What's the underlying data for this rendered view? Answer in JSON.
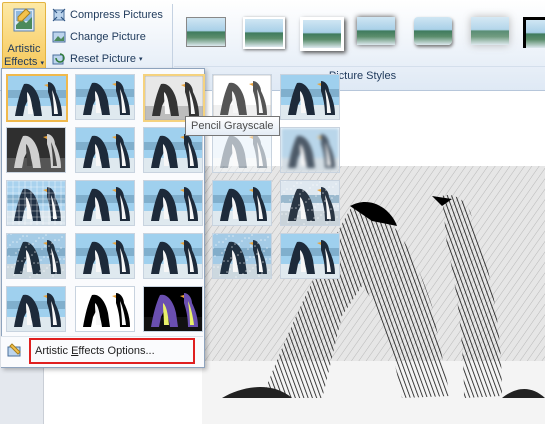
{
  "ribbon": {
    "artistic_effects": {
      "label_line1": "Artistic",
      "label_line2": "Effects",
      "caret": "▾"
    },
    "commands": [
      {
        "label": "Compress Pictures",
        "icon": "compress-pictures-icon"
      },
      {
        "label": "Change Picture",
        "icon": "change-picture-icon"
      },
      {
        "label": "Reset Picture",
        "icon": "reset-picture-icon",
        "caret": "▾"
      }
    ],
    "picture_styles_label": "Picture Styles",
    "style_thumbs": [
      "style-1",
      "style-2",
      "style-3",
      "style-4",
      "style-5",
      "style-6",
      "style-7"
    ]
  },
  "gallery": {
    "effects": [
      {
        "name": "effect-none",
        "style": "normal",
        "selected": true
      },
      {
        "name": "effect-marker",
        "style": "normal"
      },
      {
        "name": "effect-pencil-grayscale",
        "style": "gray",
        "hovered": true
      },
      {
        "name": "effect-pencil-sketch",
        "style": "sketch"
      },
      {
        "name": "effect-line-drawing",
        "style": "normal"
      },
      {
        "name": "effect-chalk-sketch",
        "style": "dark"
      },
      {
        "name": "effect-paint-strokes",
        "style": "normal"
      },
      {
        "name": "effect-paint-brush",
        "style": "normal"
      },
      {
        "name": "effect-glow-diffused",
        "style": "washed"
      },
      {
        "name": "effect-blur",
        "style": "blur"
      },
      {
        "name": "effect-light-screen",
        "style": "grid"
      },
      {
        "name": "effect-watercolor-sponge",
        "style": "normal"
      },
      {
        "name": "effect-film-grain",
        "style": "normal"
      },
      {
        "name": "effect-mosaic-bubbles",
        "style": "normal"
      },
      {
        "name": "effect-glass",
        "style": "noisy"
      },
      {
        "name": "effect-cement",
        "style": "dotted"
      },
      {
        "name": "effect-texturizer",
        "style": "normal"
      },
      {
        "name": "effect-crisscross-etching",
        "style": "normal"
      },
      {
        "name": "effect-pastels-smooth",
        "style": "dotted"
      },
      {
        "name": "effect-plastic-wrap",
        "style": "normal"
      },
      {
        "name": "effect-photocopy",
        "style": "normal"
      },
      {
        "name": "effect-cutout",
        "style": "contrast"
      },
      {
        "name": "effect-glow-edges",
        "style": "glow"
      }
    ],
    "tooltip": "Pencil Grayscale",
    "options": {
      "prefix": "Artistic ",
      "accel": "E",
      "suffix": "ffects Options..."
    }
  },
  "colors": {
    "accent_border": "#f0b94c",
    "highlight_box": "#e02020",
    "ribbon_text": "#1e395b"
  }
}
